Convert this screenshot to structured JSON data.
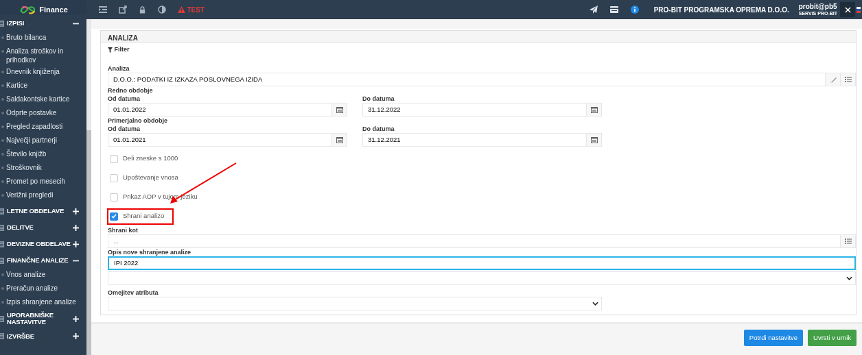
{
  "app": {
    "title": "Finance"
  },
  "toolbar": {
    "badge": "TEST",
    "company": "PRO-BIT PROGRAMSKA OPREMA D.O.O.",
    "user": "probit@pb5",
    "subtitle": "SERVIS PRO-BIT"
  },
  "sidebar": {
    "sections": [
      {
        "label": "IZPISI",
        "expanded": true,
        "children": [
          {
            "label": "Bruto bilanca"
          },
          {
            "label": "Analiza stroškov in prihodkov"
          },
          {
            "label": "Dnevnik knjiženja"
          },
          {
            "label": "Kartice"
          },
          {
            "label": "Saldakontske kartice"
          },
          {
            "label": "Odprte postavke"
          },
          {
            "label": "Pregled zapadlosti"
          },
          {
            "label": "Največji partnerji"
          },
          {
            "label": "Število knjižb"
          },
          {
            "label": "Stroškovnik"
          },
          {
            "label": "Promet po mesecih"
          },
          {
            "label": "Verižni pregledi"
          }
        ]
      },
      {
        "label": "LETNE OBDELAVE",
        "expanded": false
      },
      {
        "label": "DELITVE",
        "expanded": false
      },
      {
        "label": "DEVIZNE OBDELAVE",
        "expanded": false
      },
      {
        "label": "FINANČNE ANALIZE",
        "expanded": true,
        "children": [
          {
            "label": "Vnos analize"
          },
          {
            "label": "Preračun analize"
          },
          {
            "label": "Izpis shranjene analize"
          }
        ]
      },
      {
        "label": "UPORABNIŠKE NASTAVITVE",
        "expanded": false
      },
      {
        "label": "IZVRŠBE",
        "expanded": false
      }
    ]
  },
  "panel": {
    "title": "ANALIZA",
    "filter": "Filter",
    "analysis": {
      "label": "Analiza",
      "value": "D.O.O.: PODATKI IZ IZKAZA POSLOVNEGA IZIDA"
    },
    "periods": [
      {
        "title": "Redno obdobje",
        "from_label": "Od datuma",
        "from": "01.01.2022",
        "to_label": "Do datuma",
        "to": "31.12.2022"
      },
      {
        "title": "Primerjalno obdobje",
        "from_label": "Od datuma",
        "from": "01.01.2021",
        "to_label": "Do datuma",
        "to": "31.12.2021"
      }
    ],
    "checkboxes": [
      {
        "label": "Deli zneske s 1000",
        "checked": false,
        "highlighted": false
      },
      {
        "label": "Upoštevanje vnosa",
        "checked": false,
        "highlighted": false
      },
      {
        "label": "Prikaz AOP v tujem jeziku",
        "checked": false,
        "highlighted": false
      },
      {
        "label": "Shrani analizo",
        "checked": true,
        "highlighted": true
      }
    ],
    "save_as": {
      "label": "Shrani kot",
      "placeholder": "..."
    },
    "description": {
      "label": "Opis nove shranjene analize",
      "value": "IPI 2022",
      "focused": true
    },
    "attribute": {
      "label": "Omejitev atributa"
    }
  },
  "buttons": [
    {
      "label": "Potrdi nastavitve",
      "kind": "primary"
    },
    {
      "label": "Uvrsti v urnik",
      "kind": "success"
    }
  ]
}
